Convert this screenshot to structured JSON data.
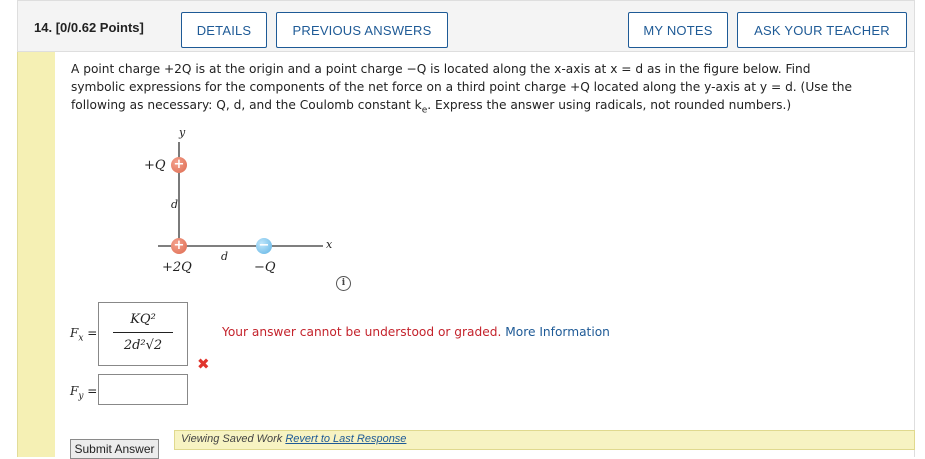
{
  "header": {
    "question_number": "14.",
    "points": "[0/0.62 Points]",
    "details_label": "DETAILS",
    "previous_answers_label": "PREVIOUS ANSWERS",
    "my_notes_label": "MY NOTES",
    "ask_teacher_label": "ASK YOUR TEACHER"
  },
  "question": {
    "text_a": "A point charge +2Q is at the origin and a point charge −Q is located along the x-axis at x = d as in the figure below. Find symbolic expressions for the components of the net force on a third point charge +Q located along the y-axis at y = d. (Use the following as necessary: Q, d, and the Coulomb constant k",
    "text_sub": "e",
    "text_b": ". Express the answer using radicals, not rounded numbers.)"
  },
  "figure": {
    "y_axis": "y",
    "x_axis": "x",
    "top_charge": "+Q",
    "origin_charge": "+2Q",
    "right_charge": "−Q",
    "vertical_distance": "d",
    "horizontal_distance": "d",
    "plus_sign": "+",
    "minus_sign": "−"
  },
  "answers": {
    "fx_label": "F",
    "fx_sub": "x",
    "fy_label": "F",
    "fy_sub": "y",
    "equals": "=",
    "fx_numerator": "KQ²",
    "fx_denominator": "2d²√2",
    "fy_value": ""
  },
  "feedback": {
    "message": "Your answer cannot be understood or graded. ",
    "more_info": "More Information"
  },
  "info_symbol": "i",
  "wrong_mark": "✖",
  "submit_label": "Submit Answer",
  "viewing": {
    "text": "Viewing Saved Work ",
    "revert": "Revert to Last Response"
  }
}
